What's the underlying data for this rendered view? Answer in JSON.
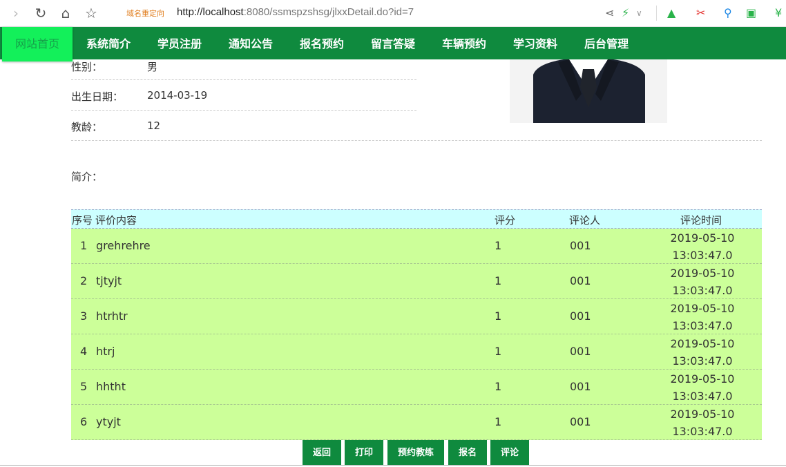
{
  "browser": {
    "redirect_label": "域名重定向",
    "url_host": "http://localhost",
    "url_rest": ":8080/ssmspzshsg/jlxxDetail.do?id=7"
  },
  "nav": {
    "items": [
      "网站首页",
      "系统简介",
      "学员注册",
      "通知公告",
      "报名预约",
      "留言答疑",
      "车辆预约",
      "学习资料",
      "后台管理"
    ]
  },
  "detail": {
    "gender_label": "性别：",
    "gender_value": "男",
    "birth_label": "出生日期：",
    "birth_value": "2014-03-19",
    "teach_age_label": "教龄：",
    "teach_age_value": "12",
    "intro_label": "简介："
  },
  "comments": {
    "headers": {
      "idx": "序号",
      "content": "评价内容",
      "score": "评分",
      "user": "评论人",
      "time": "评论时间"
    },
    "rows": [
      {
        "idx": "1",
        "content": "grehrehre",
        "score": "1",
        "user": "001",
        "date": "2019-05-10",
        "clock": "13:03:47.0"
      },
      {
        "idx": "2",
        "content": "tjtyjt",
        "score": "1",
        "user": "001",
        "date": "2019-05-10",
        "clock": "13:03:47.0"
      },
      {
        "idx": "3",
        "content": "htrhtr",
        "score": "1",
        "user": "001",
        "date": "2019-05-10",
        "clock": "13:03:47.0"
      },
      {
        "idx": "4",
        "content": "htrj",
        "score": "1",
        "user": "001",
        "date": "2019-05-10",
        "clock": "13:03:47.0"
      },
      {
        "idx": "5",
        "content": "hhtht",
        "score": "1",
        "user": "001",
        "date": "2019-05-10",
        "clock": "13:03:47.0"
      },
      {
        "idx": "6",
        "content": "ytyjt",
        "score": "1",
        "user": "001",
        "date": "2019-05-10",
        "clock": "13:03:47.0"
      }
    ]
  },
  "buttons": {
    "back": "返回",
    "print": "打印",
    "book_coach": "预约教练",
    "signup": "报名",
    "comment": "评论"
  },
  "colors": {
    "nav_bg": "#0f8a3e",
    "nav_active": "#13f05a",
    "table_head": "#ccffff",
    "table_row": "#ccff99"
  }
}
